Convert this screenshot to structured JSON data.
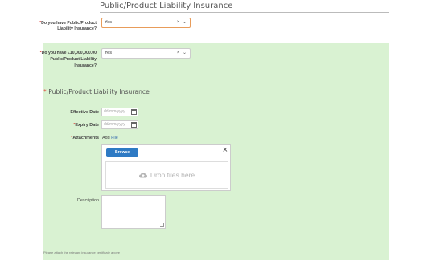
{
  "section_title": "Public/Product Liability Insurance",
  "required_mark": "*",
  "question1": {
    "label": "Do you have Public/Product Liability Insurance?",
    "value": "Yes",
    "clear_symbol": "×",
    "dropdown_symbol": "⌄"
  },
  "question2": {
    "label": "Do you have £10,000,000.00 Public/Product Liability Insurance?",
    "value": "Yes",
    "clear_symbol": "×",
    "dropdown_symbol": "⌄"
  },
  "subsection": {
    "title": "Public/Product Liability Insurance",
    "effective_date": {
      "label": "Effective Date",
      "placeholder": "dd/mm/yyyy"
    },
    "expiry_date": {
      "label": "Expiry Date",
      "placeholder": "dd/mm/yyyy"
    },
    "attachments": {
      "label": "Attachments",
      "add_text": "Add",
      "file_link": "File",
      "browse_label": "Browse",
      "close_symbol": "×",
      "drop_text": "Drop files here"
    },
    "description": {
      "label": "Description",
      "value": ""
    }
  },
  "footer_note": "Please attach the relevant insurance certificate above",
  "colors": {
    "panel_bg": "#d9f2d2",
    "required": "#e0332b",
    "browse_button": "#2e7ac4",
    "focus_border": "#e89c5a"
  },
  "icons": {
    "calendar": "calendar-icon",
    "cloud_upload": "cloud-upload-icon",
    "clear": "clear-icon",
    "dropdown": "chevron-down-icon",
    "close": "close-icon"
  }
}
